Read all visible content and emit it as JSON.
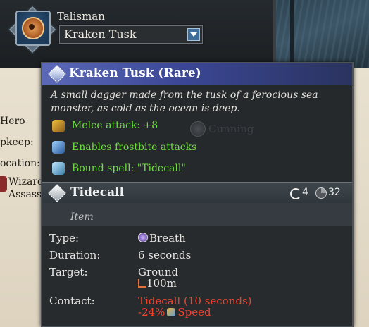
{
  "background": {
    "left_labels": [
      "Hero",
      "pkeep:",
      "ocation:",
      "Wizard",
      "Assass"
    ]
  },
  "slot": {
    "label": "Talisman",
    "selected": "Kraken Tusk",
    "emblem_icon": "talisman-emblem-icon"
  },
  "item": {
    "title": "Kraken Tusk (Rare)",
    "description": "A small dagger made from the tusk of a ferocious sea monster, as cold as the ocean is deep.",
    "effects": [
      {
        "icon": "sword-icon",
        "text": "Melee attack: +8"
      },
      {
        "icon": "frostbite-icon",
        "text": "Enables frostbite attacks"
      },
      {
        "icon": "bound-spell-icon",
        "text": "Bound spell: \"Tidecall\""
      }
    ],
    "rarity_color": "#3b4795",
    "effect_color": "#6ee03e"
  },
  "background_stat": {
    "label": "Cunning"
  },
  "spell": {
    "name": "Tidecall",
    "uses": "4",
    "cooldown": "32",
    "category": "Item",
    "rows": {
      "type_label": "Type:",
      "type_value": "Breath",
      "duration_label": "Duration:",
      "duration_value": "6 seconds",
      "target_label": "Target:",
      "target_value": "Ground",
      "range_value": "100m",
      "contact_label": "Contact:",
      "contact_value": "Tidecall (10 seconds)",
      "contact_mod_value": "-24%",
      "contact_mod_stat": "Speed"
    },
    "contact_color": "#f2432f"
  }
}
